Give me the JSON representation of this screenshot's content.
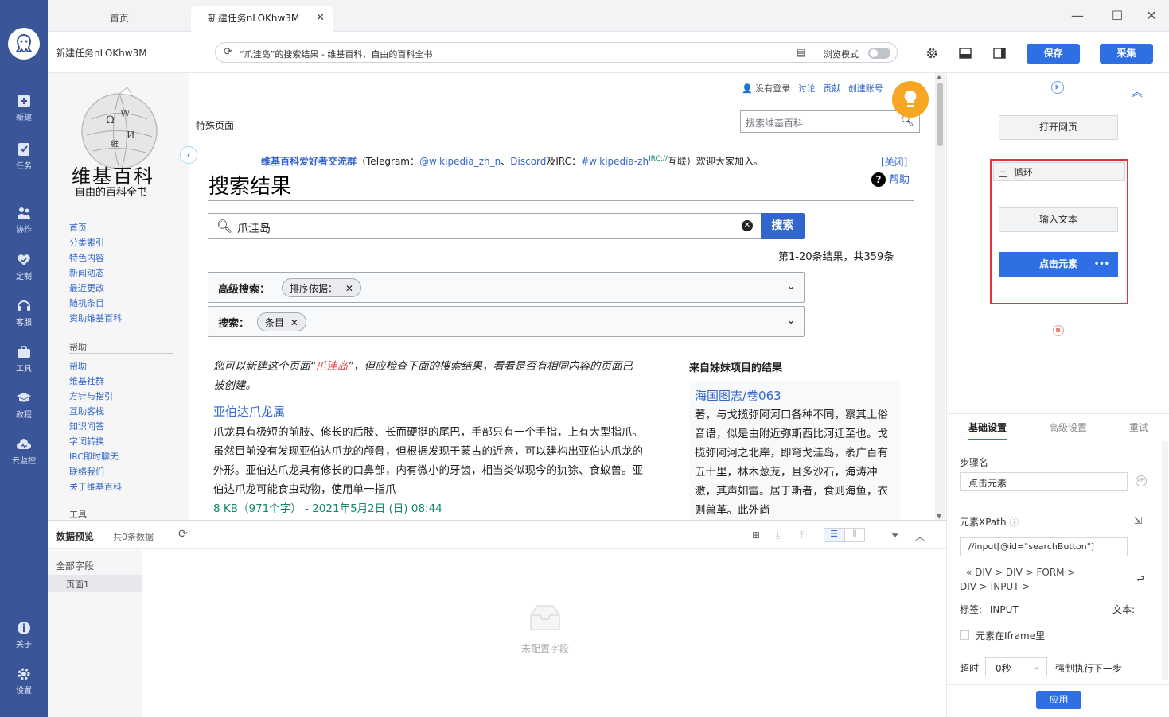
{
  "sidebar": {
    "items": [
      {
        "label": "新建",
        "icon": "plus-square-icon"
      },
      {
        "label": "任务",
        "icon": "flag-icon"
      },
      {
        "label": "协作",
        "icon": "people-icon"
      },
      {
        "label": "定制",
        "icon": "heart-icon"
      },
      {
        "label": "客服",
        "icon": "headset-icon"
      },
      {
        "label": "工具",
        "icon": "toolbox-icon"
      },
      {
        "label": "教程",
        "icon": "graduation-cap-icon"
      },
      {
        "label": "云监控",
        "icon": "cloud-icon"
      }
    ],
    "bottom": [
      {
        "label": "关于",
        "icon": "info-icon"
      },
      {
        "label": "设置",
        "icon": "gear-icon"
      }
    ]
  },
  "tabs": [
    {
      "label": "首页"
    },
    {
      "label": "新建任务nLOKhw3M"
    }
  ],
  "window": {
    "minimize": "—",
    "maximize": "☐",
    "close": "✕"
  },
  "toolbar": {
    "task_name": "新建任务nLOKhw3M",
    "url_text": "“爪洼岛”的搜索结果 - 维基百科，自由的百科全书",
    "browse_mode": "浏览模式",
    "save_label": "保存",
    "collect_label": "采集"
  },
  "wiki": {
    "name": "维基百科",
    "slogan": "自由的百科全书",
    "nav": [
      "首页",
      "分类索引",
      "特色内容",
      "新闻动态",
      "最近更改",
      "随机条目",
      "资助维基百科"
    ],
    "help_head": "帮助",
    "help_links": [
      "帮助",
      "维基社群",
      "方针与指引",
      "互助客栈",
      "知识问答",
      "字词转换",
      "IRC即时聊天",
      "联络我们",
      "关于维基百科"
    ],
    "tools_head": "工具",
    "personal": {
      "not_logged": "没有登录",
      "talk": "讨论",
      "contrib": "贡献",
      "create": "创建账号"
    },
    "special_tab": "特殊页面",
    "search_placeholder": "搜索维基百科",
    "notice": {
      "group": "维基百科爱好者交流群",
      "p1": "（Telegram：",
      "tg": "@wikipedia_zh_n",
      "p2": "、",
      "discord": "Discord",
      "p3": "及IRC：",
      "irc": "#wikipedia-zh",
      "irc_sup": "IRC://",
      "p4": "互联）欢迎大家加入。",
      "close": "[关闭]"
    },
    "help_label": "帮助",
    "page_title": "搜索结果",
    "search_value": "爪洼岛",
    "search_btn": "搜索",
    "results_info": "第1-20条结果，共359条",
    "advanced_label": "高级搜索：",
    "sort_chip": "排序依据：",
    "search_label": "搜索：",
    "entry_chip": "条目",
    "create_tip_1": "您可以新建这个页面“",
    "create_tip_term": "爪洼岛",
    "create_tip_2": "”，但应检查下面的搜索结果，看看是否有相同内容的页面已被创建。",
    "result_title": "亚伯达爪龙属",
    "result_snippet": "爪龙具有极短的前肢、修长的后肢、长而硬挺的尾巴，手部只有一个手指，上有大型指爪。虽然目前没有发现亚伯达爪龙的颅骨，但根据发现于蒙古的近亲，可以建构出亚伯达爪龙的外形。亚伯达爪龙具有修长的口鼻部，内有微小的牙齿，相当类似现今的犰狳、食蚁兽。亚伯达爪龙可能食虫动物，使用单一指爪",
    "result_meta": "8 KB（971个字） - 2021年5月2日 (日) 08:44",
    "sister_head": "来自姊妹项目的结果",
    "sister_title": "海国图志/卷063",
    "sister_snippet": "著，与戈揽弥阿河口各种不同，察其土俗音语，似是由附近弥斯西比河迁至也。戈揽弥阿河之北岸，即穹戈洼岛，袤广百有五十里，林木葱茏，且多沙石，海涛冲激，其声如雷。居于斯者，食则海鱼，衣则兽革。此外尚"
  },
  "flow": {
    "open_page": "打开网页",
    "loop": "循环",
    "input_text": "输入文本",
    "click_element": "点击元素",
    "more": "•••"
  },
  "settings": {
    "tabs": [
      "基础设置",
      "高级设置",
      "重试"
    ],
    "step_name_label": "步骤名",
    "step_name_value": "点击元素",
    "xpath_label": "元素XPath",
    "xpath_value": "//input[@id=\"searchButton\"]",
    "path_line1": "«  DIV  >  DIV  >  FORM  >",
    "path_line2": "DIV  >  INPUT  >",
    "tag_label": "标签:",
    "tag_value": "INPUT",
    "text_label": "文本:",
    "iframe_label": "元素在Iframe里",
    "timeout_label": "超时",
    "timeout_value": "0秒",
    "force_next": "强制执行下一步",
    "apply": "应用"
  },
  "preview": {
    "title": "数据预览",
    "count": "共0条数据",
    "all_fields": "全部字段",
    "page1": "页面1",
    "empty": "未配置字段"
  }
}
